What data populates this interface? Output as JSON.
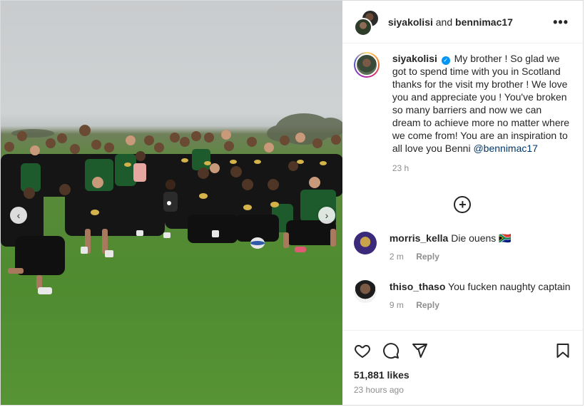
{
  "header": {
    "user1": "siyakolisi",
    "joiner": "and",
    "user2": "bennimac17",
    "more_icon": "more-horizontal-icon"
  },
  "caption": {
    "username": "siyakolisi",
    "verified_icon": "verified-badge-icon",
    "text": "My brother ! So glad we got to spend time with you in Scotland thanks for the visit my brother ! We love you and appreciate you ! You've broken so many barriers and now we can dream to achieve more no matter where we come from! You are an inspiration to all love you Benni",
    "mention": "@bennimac17",
    "time": "23 h"
  },
  "load_more_icon": "plus-circle-icon",
  "comments": [
    {
      "username": "morris_kella",
      "text": "Die ouens 🇿🇦",
      "time": "2 m",
      "reply": "Reply"
    },
    {
      "username": "thiso_thaso",
      "text": "You fucken naughty captain",
      "time": "9 m",
      "reply": "Reply"
    }
  ],
  "actions": {
    "like_icon": "heart-icon",
    "comment_icon": "comment-icon",
    "share_icon": "send-icon",
    "save_icon": "bookmark-icon"
  },
  "likes": "51,881 likes",
  "posted": "23 hours ago",
  "media": {
    "prev_icon": "chevron-left-icon",
    "next_icon": "chevron-right-icon",
    "prev_glyph": "‹",
    "next_glyph": "›"
  }
}
